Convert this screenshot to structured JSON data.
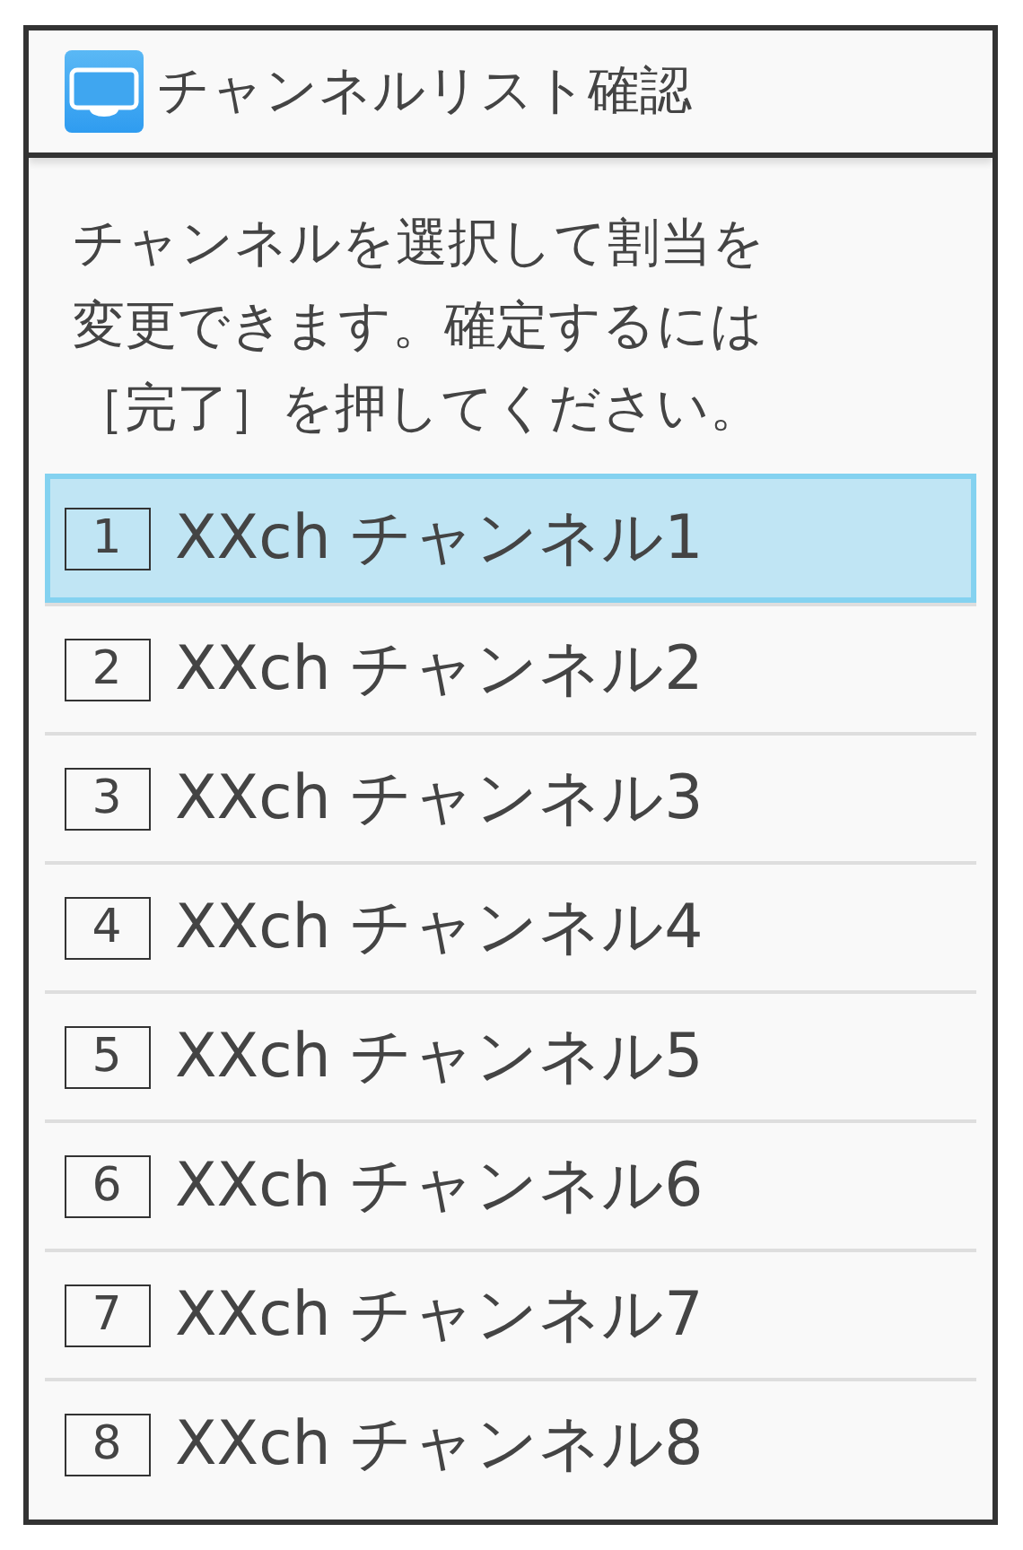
{
  "window": {
    "title": "チャンネルリスト確認"
  },
  "instructions": [
    "チャンネルを選択して割当を",
    "変更できます。確定するには",
    "［完了］を押してください。"
  ],
  "channels": [
    {
      "number": "1",
      "label": "XXch チャンネル1",
      "selected": true
    },
    {
      "number": "2",
      "label": "XXch チャンネル2",
      "selected": false
    },
    {
      "number": "3",
      "label": "XXch チャンネル3",
      "selected": false
    },
    {
      "number": "4",
      "label": "XXch チャンネル4",
      "selected": false
    },
    {
      "number": "5",
      "label": "XXch チャンネル5",
      "selected": false
    },
    {
      "number": "6",
      "label": "XXch チャンネル6",
      "selected": false
    },
    {
      "number": "7",
      "label": "XXch チャンネル7",
      "selected": false
    },
    {
      "number": "8",
      "label": "XXch チャンネル8",
      "selected": false
    }
  ]
}
